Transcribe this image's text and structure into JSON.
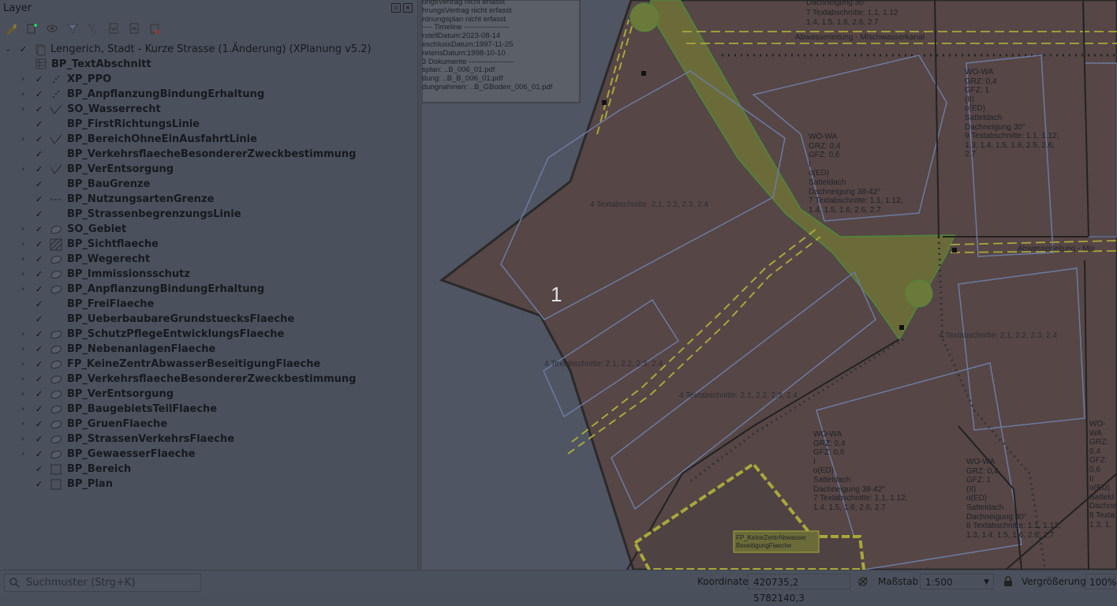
{
  "panel": {
    "title": "Layer",
    "toolbar_icons": [
      "open-layer-styling-icon",
      "add-group-icon",
      "manage-map-themes-icon",
      "filter-legend-icon",
      "filter-by-expression-icon",
      "expand-all-icon",
      "collapse-all-icon",
      "remove-layer-icon"
    ],
    "project": "Lengerich, Stadt - Kurze Strasse (1.Änderung) (XPlanung v5.2)",
    "text_layer": "BP_TextAbschnitt",
    "layers": [
      {
        "label": "XP_PPO",
        "icon": "point-icon"
      },
      {
        "label": "BP_AnpflanzungBindungErhaltung",
        "icon": "point-icon"
      },
      {
        "label": "SO_Wasserrecht",
        "icon": "line-icon"
      },
      {
        "label": "BP_FirstRichtungsLinie",
        "icon": "none"
      },
      {
        "label": "BP_BereichOhneEinAusfahrtLinie",
        "icon": "line-icon"
      },
      {
        "label": "BP_VerkehrsflaecheBesondererZweckbestimmung",
        "icon": "none"
      },
      {
        "label": "BP_VerEntsorgung",
        "icon": "line-icon"
      },
      {
        "label": "BP_BauGrenze",
        "icon": "none"
      },
      {
        "label": "BP_NutzungsartenGrenze",
        "icon": "dashed-line-icon"
      },
      {
        "label": "BP_StrassenbegrenzungsLinie",
        "icon": "none"
      },
      {
        "label": "SO_Gebiet",
        "icon": "polygon-icon"
      },
      {
        "label": "BP_Sichtflaeche",
        "icon": "hatched-polygon-icon"
      },
      {
        "label": "BP_Wegerecht",
        "icon": "polygon-icon"
      },
      {
        "label": "BP_Immissionsschutz",
        "icon": "polygon-icon"
      },
      {
        "label": "BP_AnpflanzungBindungErhaltung",
        "icon": "polygon-icon"
      },
      {
        "label": "BP_FreiFlaeche",
        "icon": "none"
      },
      {
        "label": "BP_UeberbaubareGrundstuecksFlaeche",
        "icon": "none"
      },
      {
        "label": "BP_SchutzPflegeEntwicklungsFlaeche",
        "icon": "polygon-icon"
      },
      {
        "label": "BP_NebenanlagenFlaeche",
        "icon": "polygon-icon"
      },
      {
        "label": "FP_KeineZentrAbwasserBeseitigungFlaeche",
        "icon": "polygon-icon"
      },
      {
        "label": "BP_VerkehrsflaecheBesondererZweckbestimmung",
        "icon": "polygon-icon"
      },
      {
        "label": "BP_VerEntsorgung",
        "icon": "polygon-icon"
      },
      {
        "label": "BP_BaugebietsTeilFlaeche",
        "icon": "polygon-icon"
      },
      {
        "label": "BP_GruenFlaeche",
        "icon": "polygon-icon"
      },
      {
        "label": "BP_StrassenVerkehrsFlaeche",
        "icon": "polygon-icon"
      },
      {
        "label": "BP_GewaesserFlaeche",
        "icon": "polygon-icon"
      },
      {
        "label": "BP_Bereich",
        "icon": "square-icon"
      },
      {
        "label": "BP_Plan",
        "icon": "square-icon"
      }
    ]
  },
  "map": {
    "callout_lines": [
      "ungsVertrag nicht erfasst",
      "hrungsVertrag nicht erfasst",
      "rdnungsplan nicht erfasst",
      "---- Timeline ------------------",
      "rstellDatum:2023-08-14",
      "eschlussDatum:1997-11-25",
      "retensDatum:1998-10-10",
      "3 Dokumente ------------------",
      "splan: ..B_006_01.pdf",
      "dung: ..B_B_006_01.pdf",
      "dungnahmen: ..B_GBoden_006_01.pdf"
    ],
    "marker_number": "1",
    "labels": {
      "dachneigung_30_top": "Dachneigung 30°",
      "textabschnitte_top": "7 Textabschnitte: 1.1, 1.12",
      "textab_rest_top": "1.4, 1.5, 1.6, 2.6, 2.7",
      "abwasser_top": "Abwasserleitung - Mischwasserkanal",
      "abwasser_right": "Abwasserleitung - Mis",
      "ta_center": "4 Textabschnitte: 2.1, 2.2, 2.3, 2.4",
      "ta_lower": "4 Textabschnitte: 2.1, 2.2, 2.3, 2.4",
      "ta_lower2": "4 Textabschnitte: 2.1, 2.2, 2.3, 2.4",
      "ta_right": "4 Textabschnitte: 2.1, 2.2, 2.3, 2.4",
      "fp_label_1": "FP_KeineZentrAbwasser",
      "fp_label_2": "BeseitigungFlaeche"
    },
    "nutzung_a": [
      "WO-WA",
      "GRZ: 0,4",
      "GFZ: 0,6",
      "I",
      "o(ED)",
      "Satteldach",
      "Dachneigung 38-42°",
      "7 Textabschnitte: 1.1, 1.12,",
      "1.4, 1.5, 1.6, 2.6, 2.7"
    ],
    "nutzung_b": [
      "WO-WA",
      "GRZ: 0,4",
      "GFZ: 1",
      "(II)",
      "o(ED)",
      "Satteldach",
      "Dachneigung 30°",
      "9 Textabschnitte: 1.1, 1.12,",
      "1.3, 1.4, 1.5, 1.6, 2.5, 2.6,",
      "2.7"
    ],
    "nutzung_c": [
      "WO-WA",
      "GRZ: 0,4",
      "GFZ: 0,6",
      "I",
      "o(ED)",
      "Satteldach",
      "Dachneigung 38-42°",
      "7 Textabschnitte: 1.1, 1.12,",
      "1.4, 1.5, 1.6, 2.6, 2.7"
    ],
    "nutzung_d": [
      "WO-WA",
      "GRZ: 0,4",
      "GFZ: 1",
      "(II)",
      "o(ED)",
      "Satteldach",
      "Dachneigung 30°",
      "8 Textabschnitte: 1.1, 1.12,",
      "1.3, 1.4, 1.5, 1.6, 2.6, 2.7"
    ],
    "nutzung_e": [
      "WO-WA",
      "GRZ: 0,4",
      "GFZ: 0,6",
      "II",
      "o(ED)",
      "Satteld",
      "Dachne",
      "8 Texta",
      "1.3, 1."
    ]
  },
  "status": {
    "search_placeholder": "Suchmuster (Strg+K)",
    "coord_label": "Koordinate",
    "coord_value": "420735,2  5782140,3",
    "scale_label": "Maßstab",
    "scale_value": "1:500",
    "magnifier_label": "Vergrößerung",
    "magnifier_value": "100%"
  },
  "colors": {
    "parcel_fill": "#5a4848",
    "green_fill": "#6b6b3a",
    "baugrenze": "#6b7ba0",
    "yellow": "#a7a83a"
  }
}
